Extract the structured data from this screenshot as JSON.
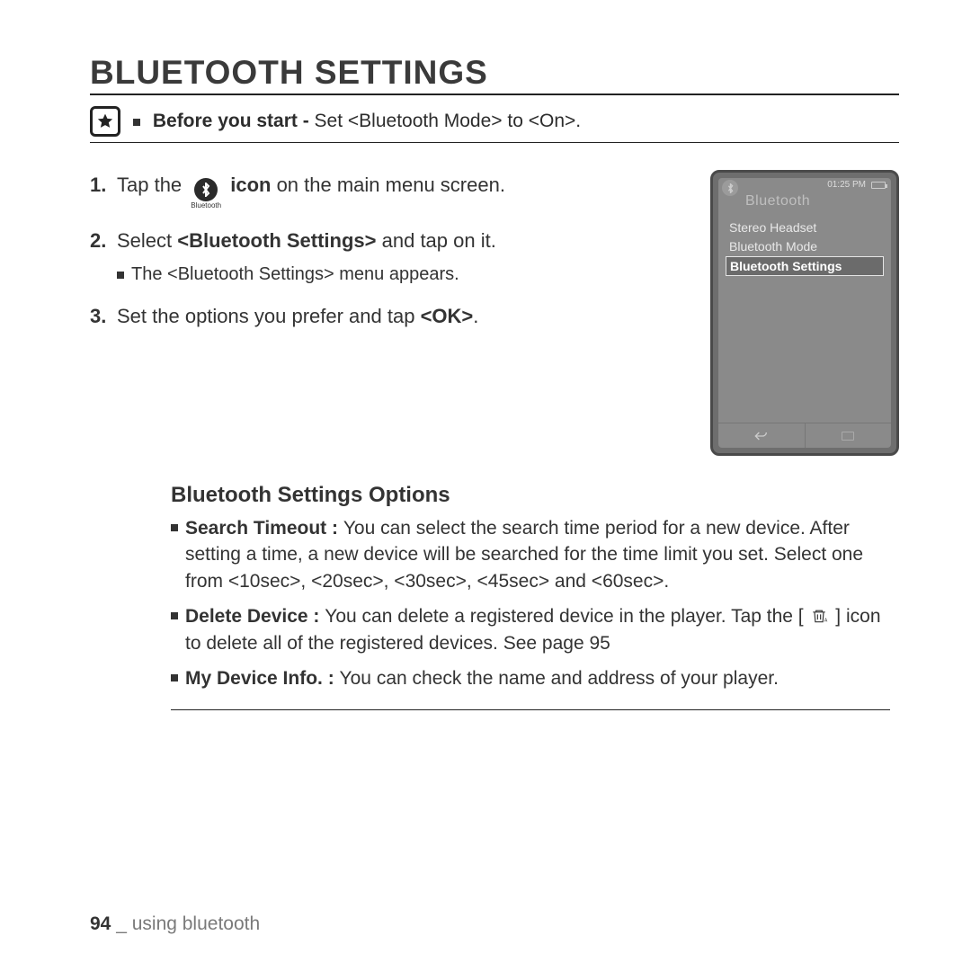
{
  "title": "BLUETOOTH SETTINGS",
  "prestart": {
    "bold": "Before you start - ",
    "rest": "Set <Bluetooth Mode> to <On>."
  },
  "steps": {
    "s1_a": "Tap the ",
    "s1_iconlabel": "Bluetooth",
    "s1_bold": " icon",
    "s1_b": " on the main menu screen.",
    "s2_a": "Select ",
    "s2_bold": "<Bluetooth Settings>",
    "s2_b": " and tap on it.",
    "s2_note": "The <Bluetooth Settings> menu appears.",
    "s3_a": "Set the options you prefer and tap ",
    "s3_bold": "<OK>",
    "s3_b": "."
  },
  "device": {
    "time": "01:25 PM",
    "header": "Bluetooth",
    "items": [
      "Stereo Headset",
      "Bluetooth Mode",
      "Bluetooth Settings"
    ],
    "selected_index": 2
  },
  "options": {
    "heading": "Bluetooth Settings Options",
    "o1_bold": "Search Timeout : ",
    "o1_text": "You can select the search time period for a new device. After setting a time, a new device will be searched for the time limit you set. Select one from <10sec>, <20sec>, <30sec>, <45sec> and <60sec>.",
    "o2_bold": "Delete Device : ",
    "o2_text_a": "You can delete a registered device in the player. Tap the [ ",
    "o2_text_b": " ] icon to delete all of the registered devices. See page 95",
    "o3_bold": "My Device Info. : ",
    "o3_text": "You can check the name and address of your player."
  },
  "footer": {
    "page": "94",
    "sep": " _ ",
    "section": "using bluetooth"
  }
}
